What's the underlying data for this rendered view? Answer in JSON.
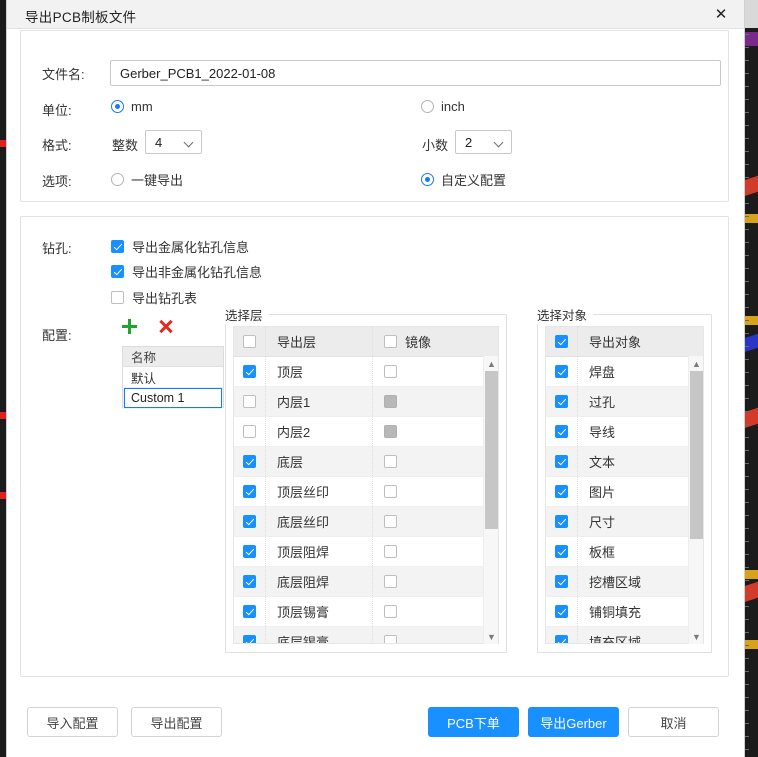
{
  "window": {
    "title": "导出PCB制板文件",
    "close_icon": "close-icon"
  },
  "file": {
    "label": "文件名:",
    "value": "Gerber_PCB1_2022-01-08",
    "placeholder": "Gerber_PCB1_2022-01-08"
  },
  "units": {
    "label": "单位:",
    "options": [
      {
        "label": "mm",
        "selected": true
      },
      {
        "label": "inch",
        "selected": false
      }
    ]
  },
  "format": {
    "label": "格式:",
    "integer_label": "整数",
    "integer_value": "4",
    "decimal_label": "小数",
    "decimal_value": "2"
  },
  "options": {
    "label": "选项:",
    "items": [
      {
        "label": "一键导出",
        "selected": false
      },
      {
        "label": "自定义配置",
        "selected": true
      }
    ]
  },
  "drill": {
    "label": "钻孔:",
    "items": [
      {
        "label": "导出金属化钻孔信息",
        "checked": true
      },
      {
        "label": "导出非金属化钻孔信息",
        "checked": true
      },
      {
        "label": "导出钻孔表",
        "checked": false
      }
    ]
  },
  "config": {
    "label": "配置:",
    "add_icon": "plus-icon",
    "delete_icon": "delete-icon",
    "header": "名称",
    "rows": [
      "默认"
    ],
    "editing_value": "Custom 1"
  },
  "layers": {
    "legend": "选择层",
    "header": {
      "export": "导出层",
      "mirror": "镜像"
    },
    "header_export_checked": false,
    "header_mirror_checked": false,
    "rows": [
      {
        "name": "顶层",
        "checked": true,
        "mirror": false,
        "mirror_disabled": false
      },
      {
        "name": "内层1",
        "checked": false,
        "mirror": false,
        "mirror_disabled": true
      },
      {
        "name": "内层2",
        "checked": false,
        "mirror": false,
        "mirror_disabled": true
      },
      {
        "name": "底层",
        "checked": true,
        "mirror": false,
        "mirror_disabled": false
      },
      {
        "name": "顶层丝印",
        "checked": true,
        "mirror": false,
        "mirror_disabled": false
      },
      {
        "name": "底层丝印",
        "checked": true,
        "mirror": false,
        "mirror_disabled": false
      },
      {
        "name": "顶层阻焊",
        "checked": true,
        "mirror": false,
        "mirror_disabled": false
      },
      {
        "name": "底层阻焊",
        "checked": true,
        "mirror": false,
        "mirror_disabled": false
      },
      {
        "name": "顶层锡膏",
        "checked": true,
        "mirror": false,
        "mirror_disabled": false
      },
      {
        "name": "底层锡膏",
        "checked": true,
        "mirror": false,
        "mirror_disabled": false
      }
    ],
    "scrollbar": {
      "up_icon": "chevron-up-icon",
      "down_icon": "chevron-down-icon"
    }
  },
  "objects": {
    "legend": "选择对象",
    "header": "导出对象",
    "header_checked": true,
    "rows": [
      {
        "name": "焊盘",
        "checked": true
      },
      {
        "name": "过孔",
        "checked": true
      },
      {
        "name": "导线",
        "checked": true
      },
      {
        "name": "文本",
        "checked": true
      },
      {
        "name": "图片",
        "checked": true
      },
      {
        "name": "尺寸",
        "checked": true
      },
      {
        "name": "板框",
        "checked": true
      },
      {
        "name": "挖槽区域",
        "checked": true
      },
      {
        "name": "铺铜填充",
        "checked": true
      },
      {
        "name": "填充区域",
        "checked": true
      }
    ],
    "scrollbar": {
      "up_icon": "chevron-up-icon",
      "down_icon": "chevron-down-icon"
    }
  },
  "footer": {
    "import_config": "导入配置",
    "export_config": "导出配置",
    "pcb_order": "PCB下单",
    "export_gerber": "导出Gerber",
    "cancel": "取消"
  },
  "colors": {
    "accent": "#1890ff",
    "link": "#1677ff",
    "add": "#23a330",
    "delete": "#e02a22",
    "header_bg": "#ececec",
    "row_alt": "#f3f3f3",
    "titlebar_bg": "#f2f2f2"
  }
}
